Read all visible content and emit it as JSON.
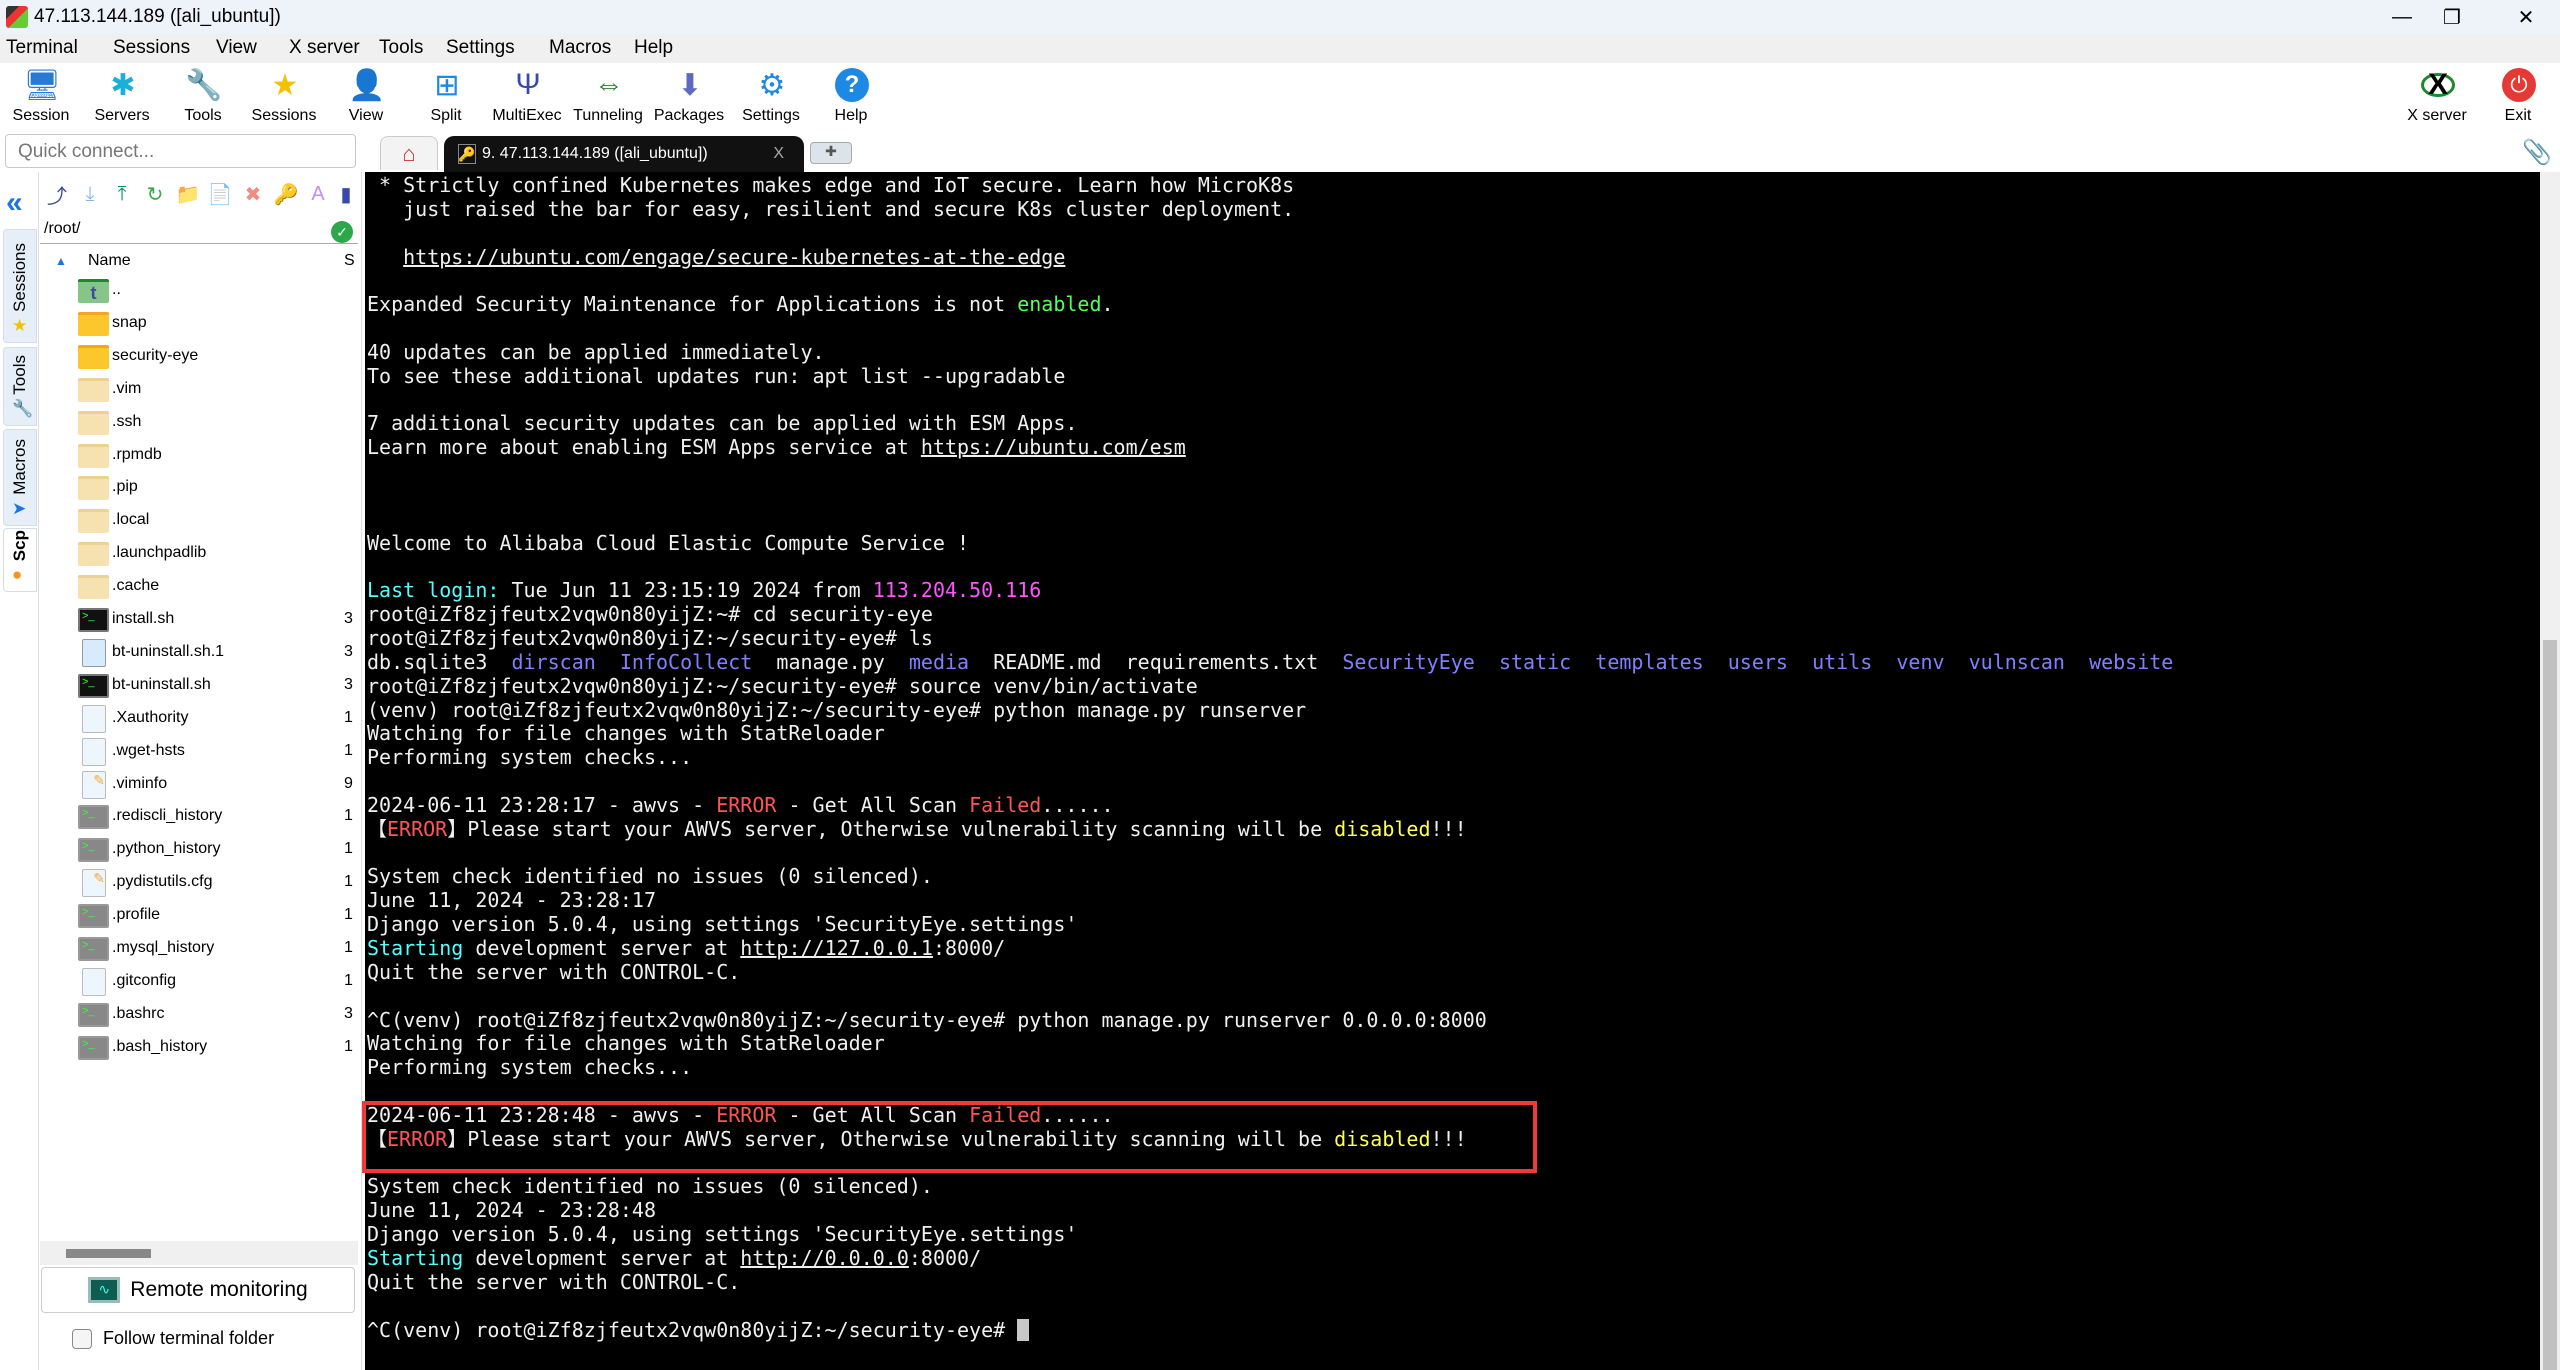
{
  "window": {
    "title": "47.113.144.189 ([ali_ubuntu])",
    "minimize": "—",
    "restore": "❐",
    "close": "✕"
  },
  "menu": [
    "Terminal",
    "Sessions",
    "View",
    "X server",
    "Tools",
    "Settings",
    "Macros",
    "Help"
  ],
  "toolbar": [
    {
      "label": "Session",
      "icon": "🖥",
      "color": "#2a7ad5"
    },
    {
      "label": "Servers",
      "icon": "✱",
      "color": "#1ab0d8"
    },
    {
      "label": "Tools",
      "icon": "🔧",
      "color": "#e53935"
    },
    {
      "label": "Sessions",
      "icon": "★",
      "color": "#f2c200"
    },
    {
      "label": "View",
      "icon": "👤",
      "color": "#333"
    },
    {
      "label": "Split",
      "icon": "⊞",
      "color": "#1e88e5"
    },
    {
      "label": "MultiExec",
      "icon": "Ψ",
      "color": "#3949ab"
    },
    {
      "label": "Tunneling",
      "icon": "⇔",
      "color": "#2e7d32"
    },
    {
      "label": "Packages",
      "icon": "⬇",
      "color": "#5c6bc0"
    },
    {
      "label": "Settings",
      "icon": "⚙",
      "color": "#1e88e5"
    },
    {
      "label": "Help",
      "icon": "?",
      "color": "#1e88e5"
    }
  ],
  "toolbar_right": [
    {
      "label": "X server",
      "icon": "X",
      "color": "#111"
    },
    {
      "label": "Exit",
      "icon": "⏻",
      "color": "#e53935"
    }
  ],
  "quick_connect": {
    "placeholder": "Quick connect..."
  },
  "tabs": {
    "home_icon": "⌂",
    "session_label": "9. 47.113.144.189 ([ali_ubuntu])",
    "close": "X",
    "plus": "✚"
  },
  "side_tabs": [
    {
      "label": "Sessions",
      "icon": "★"
    },
    {
      "label": "Tools",
      "icon": "🔧"
    },
    {
      "label": "Macros",
      "icon": "➤"
    },
    {
      "label": "Scp",
      "icon": "●"
    }
  ],
  "sftp": {
    "toolbar_icons": [
      "⤴",
      "⤓",
      "⤒",
      "↻",
      "📁",
      "📄",
      "✖",
      "🔑",
      "A",
      "▮"
    ],
    "path": "/root/",
    "col_name": "Name",
    "col_size": "S",
    "files": [
      {
        "name": "..",
        "type": "up",
        "size": ""
      },
      {
        "name": "snap",
        "type": "folder",
        "size": ""
      },
      {
        "name": "security-eye",
        "type": "folder",
        "size": ""
      },
      {
        "name": ".vim",
        "type": "hidden",
        "size": ""
      },
      {
        "name": ".ssh",
        "type": "hidden",
        "size": ""
      },
      {
        "name": ".rpmdb",
        "type": "hidden",
        "size": ""
      },
      {
        "name": ".pip",
        "type": "hidden",
        "size": ""
      },
      {
        "name": ".local",
        "type": "hidden",
        "size": ""
      },
      {
        "name": ".launchpadlib",
        "type": "hidden",
        "size": ""
      },
      {
        "name": ".cache",
        "type": "hidden",
        "size": ""
      },
      {
        "name": "install.sh",
        "type": "script",
        "size": "3"
      },
      {
        "name": "bt-uninstall.sh.1",
        "type": "doc",
        "size": "3"
      },
      {
        "name": "bt-uninstall.sh",
        "type": "script",
        "size": "3"
      },
      {
        "name": ".Xauthority",
        "type": "pdoc",
        "size": "1"
      },
      {
        "name": ".wget-hsts",
        "type": "pdoc",
        "size": "1"
      },
      {
        "name": ".viminfo",
        "type": "edit",
        "size": "9"
      },
      {
        "name": ".rediscli_history",
        "type": "gscript",
        "size": "1"
      },
      {
        "name": ".python_history",
        "type": "gscript",
        "size": "1"
      },
      {
        "name": ".pydistutils.cfg",
        "type": "edit",
        "size": "1"
      },
      {
        "name": ".profile",
        "type": "gscript",
        "size": "1"
      },
      {
        "name": ".mysql_history",
        "type": "gscript",
        "size": "1"
      },
      {
        "name": ".gitconfig",
        "type": "pdoc",
        "size": "1"
      },
      {
        "name": ".bashrc",
        "type": "gscript",
        "size": "3"
      },
      {
        "name": ".bash_history",
        "type": "gscript",
        "size": "1"
      }
    ],
    "remote_monitoring": "Remote monitoring",
    "follow_terminal": "Follow terminal folder"
  },
  "colors": {
    "white": "#f0f0f0",
    "cyan": "#55ffff",
    "green": "#55ff55",
    "magenta": "#ff55ff",
    "blue": "#8080ff",
    "red": "#ff5555",
    "yellow": "#ffff55",
    "highlight": "#f03a3a"
  },
  "terminal": [
    [
      {
        "t": " * Strictly confined Kubernetes makes edge and IoT secure. Learn how MicroK8s"
      }
    ],
    [
      {
        "t": "   just raised the bar for easy, resilient and secure K8s cluster deployment."
      }
    ],
    [],
    [
      {
        "t": "   "
      },
      {
        "t": "https://ubuntu.com/engage/secure-kubernetes-at-the-edge",
        "u": 1
      }
    ],
    [],
    [
      {
        "t": "Expanded Security Maintenance for Applications is not "
      },
      {
        "t": "enabled",
        "c": "green"
      },
      {
        "t": "."
      }
    ],
    [],
    [
      {
        "t": "40 updates can be applied immediately."
      }
    ],
    [
      {
        "t": "To see these additional updates run: apt list --upgradable"
      }
    ],
    [],
    [
      {
        "t": "7 additional security updates can be applied with ESM Apps."
      }
    ],
    [
      {
        "t": "Learn more about enabling ESM Apps service at "
      },
      {
        "t": "https://ubuntu.com/esm",
        "u": 1
      }
    ],
    [],
    [],
    [],
    [
      {
        "t": "Welcome to Alibaba Cloud Elastic Compute Service !"
      }
    ],
    [],
    [
      {
        "t": "Last login:",
        "c": "cyan"
      },
      {
        "t": " Tue Jun 11 23:15:19 2024 from "
      },
      {
        "t": "113.204.50.116",
        "c": "magenta"
      }
    ],
    [
      {
        "t": "root@iZf8zjfeutx2vqw0n80yijZ:~# cd security-eye"
      }
    ],
    [
      {
        "t": "root@iZf8zjfeutx2vqw0n80yijZ:~/security-eye# ls"
      }
    ],
    [
      {
        "t": "db.sqlite3  "
      },
      {
        "t": "dirscan",
        "c": "blue"
      },
      {
        "t": "  "
      },
      {
        "t": "InfoCollect",
        "c": "blue"
      },
      {
        "t": "  manage.py  "
      },
      {
        "t": "media",
        "c": "blue"
      },
      {
        "t": "  README.md  requirements.txt  "
      },
      {
        "t": "SecurityEye",
        "c": "blue"
      },
      {
        "t": "  "
      },
      {
        "t": "static",
        "c": "blue"
      },
      {
        "t": "  "
      },
      {
        "t": "templates",
        "c": "blue"
      },
      {
        "t": "  "
      },
      {
        "t": "users",
        "c": "blue"
      },
      {
        "t": "  "
      },
      {
        "t": "utils",
        "c": "blue"
      },
      {
        "t": "  "
      },
      {
        "t": "venv",
        "c": "blue"
      },
      {
        "t": "  "
      },
      {
        "t": "vulnscan",
        "c": "blue"
      },
      {
        "t": "  "
      },
      {
        "t": "website",
        "c": "blue"
      }
    ],
    [
      {
        "t": "root@iZf8zjfeutx2vqw0n80yijZ:~/security-eye# source venv/bin/activate"
      }
    ],
    [
      {
        "t": "(venv) root@iZf8zjfeutx2vqw0n80yijZ:~/security-eye# python manage.py runserver"
      }
    ],
    [
      {
        "t": "Watching for file changes with StatReloader"
      }
    ],
    [
      {
        "t": "Performing system checks..."
      }
    ],
    [],
    [
      {
        "t": "2024-06-11 23:28:17 - awvs - "
      },
      {
        "t": "ERROR",
        "c": "red"
      },
      {
        "t": " - Get All Scan "
      },
      {
        "t": "Failed",
        "c": "red"
      },
      {
        "t": "......"
      }
    ],
    [
      {
        "t": "【"
      },
      {
        "t": "ERROR",
        "c": "red"
      },
      {
        "t": "】Please start your AWVS server, Otherwise vulnerability scanning will be "
      },
      {
        "t": "disabled",
        "c": "yellow"
      },
      {
        "t": "!!!"
      }
    ],
    [],
    [
      {
        "t": "System check identified no issues (0 silenced)."
      }
    ],
    [
      {
        "t": "June 11, 2024 - 23:28:17"
      }
    ],
    [
      {
        "t": "Django version 5.0.4, using settings 'SecurityEye.settings'"
      }
    ],
    [
      {
        "t": "Starting",
        "c": "cyan"
      },
      {
        "t": " development server at "
      },
      {
        "t": "http://127.0.0.1",
        "u": 1
      },
      {
        "t": ":8000/"
      }
    ],
    [
      {
        "t": "Quit the server with CONTROL-C."
      }
    ],
    [],
    [
      {
        "t": "^C(venv) root@iZf8zjfeutx2vqw0n80yijZ:~/security-eye# python manage.py runserver 0.0.0.0:8000"
      }
    ],
    [
      {
        "t": "Watching for file changes with StatReloader"
      }
    ],
    [
      {
        "t": "Performing system checks..."
      }
    ],
    [],
    [
      {
        "t": "2024-06-11 23:28:48 - awvs - "
      },
      {
        "t": "ERROR",
        "c": "red"
      },
      {
        "t": " - Get All Scan "
      },
      {
        "t": "Failed",
        "c": "red"
      },
      {
        "t": "......"
      }
    ],
    [
      {
        "t": "【"
      },
      {
        "t": "ERROR",
        "c": "red"
      },
      {
        "t": "】Please start your AWVS server, Otherwise vulnerability scanning will be "
      },
      {
        "t": "disabled",
        "c": "yellow"
      },
      {
        "t": "!!!"
      }
    ],
    [],
    [
      {
        "t": "System check identified no issues (0 silenced)."
      }
    ],
    [
      {
        "t": "June 11, 2024 - 23:28:48"
      }
    ],
    [
      {
        "t": "Django version 5.0.4, using settings 'SecurityEye.settings'"
      }
    ],
    [
      {
        "t": "Starting",
        "c": "cyan"
      },
      {
        "t": " development server at "
      },
      {
        "t": "http://0.0.0.0",
        "u": 1
      },
      {
        "t": ":8000/"
      }
    ],
    [
      {
        "t": "Quit the server with CONTROL-C."
      }
    ],
    [],
    [
      {
        "t": "^C(venv) root@iZf8zjfeutx2vqw0n80yijZ:~/security-eye# "
      }
    ]
  ]
}
